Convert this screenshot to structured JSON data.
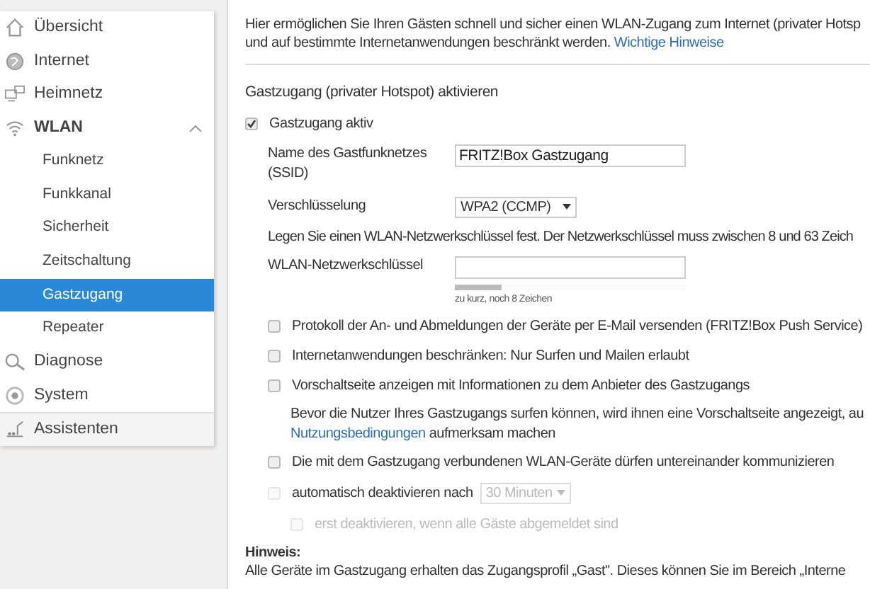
{
  "sidebar": {
    "items": [
      {
        "label": "Übersicht",
        "selected": false
      },
      {
        "label": "Internet",
        "selected": false
      },
      {
        "label": "Heimnetz",
        "selected": false
      },
      {
        "label": "WLAN",
        "selected": false,
        "expanded": true,
        "children": [
          {
            "label": "Funknetz",
            "selected": false
          },
          {
            "label": "Funkkanal",
            "selected": false
          },
          {
            "label": "Sicherheit",
            "selected": false
          },
          {
            "label": "Zeitschaltung",
            "selected": false
          },
          {
            "label": "Gastzugang",
            "selected": true
          },
          {
            "label": "Repeater",
            "selected": false
          }
        ]
      },
      {
        "label": "Diagnose",
        "selected": false
      },
      {
        "label": "System",
        "selected": false
      }
    ],
    "footer": {
      "label": "Assistenten"
    }
  },
  "main": {
    "intro": [
      "Hier ermöglichen Sie Ihren Gästen schnell und sicher einen WLAN-Zugang zum Internet (privater Hotsp",
      "und auf bestimmte Internetanwendungen beschränkt werden. "
    ],
    "intro_link": "Wichtige Hinweise",
    "heading": "Gastzugang (privater Hotspot) aktivieren",
    "enable": {
      "label": "Gastzugang aktiv",
      "checked": true
    },
    "ssid": {
      "label": "Name des Gastfunknetzes (SSID)",
      "value": "FRITZ!Box Gastzugang"
    },
    "encryption": {
      "label": "Verschlüsselung",
      "value": "WPA2 (CCMP)"
    },
    "key_note": "Legen Sie einen WLAN-Netzwerkschlüssel fest. Der Netzwerkschlüssel muss zwischen 8 und 63 Zeich",
    "key": {
      "label": "WLAN-Netzwerkschlüssel",
      "level": 0.2,
      "hint": "zu kurz, noch 8 Zeichen"
    },
    "options": [
      {
        "kind": "check",
        "label": "Protokoll der An- und Abmeldungen der Geräte per E-Mail versenden (FRITZ!Box Push Service)",
        "checked": false
      },
      {
        "kind": "check",
        "label": "Internetanwendungen beschränken: Nur Surfen und Mailen erlaubt",
        "checked": false
      },
      {
        "kind": "check",
        "label": "Vorschaltseite anzeigen mit Informationen zu dem Anbieter des Gastzugangs",
        "checked": false
      },
      {
        "kind": "note",
        "lines": [
          "Bevor die Nutzer Ihres Gastzugangs surfen können, wird ihnen eine Vorschaltseite angezeigt, au"
        ],
        "link": "Nutzungsbedingungen",
        "after": " aufmerksam machen"
      },
      {
        "kind": "check",
        "label": "Die mit dem Gastzugang verbundenen WLAN-Geräte dürfen untereinander kommunizieren",
        "checked": false
      },
      {
        "kind": "timer",
        "label": "automatisch deaktivieren nach",
        "checked": false,
        "select": "30 Minuten",
        "disabled": true
      },
      {
        "kind": "subcheck",
        "label": "erst deaktivieren, wenn alle Gäste abgemeldet sind",
        "checked": false,
        "disabled": true
      }
    ],
    "notice_title": "Hinweis:",
    "notice": "Alle Geräte im Gastzugang erhalten das Zugangsprofil „Gast\". Dieses können Sie im Bereich „Interne"
  }
}
